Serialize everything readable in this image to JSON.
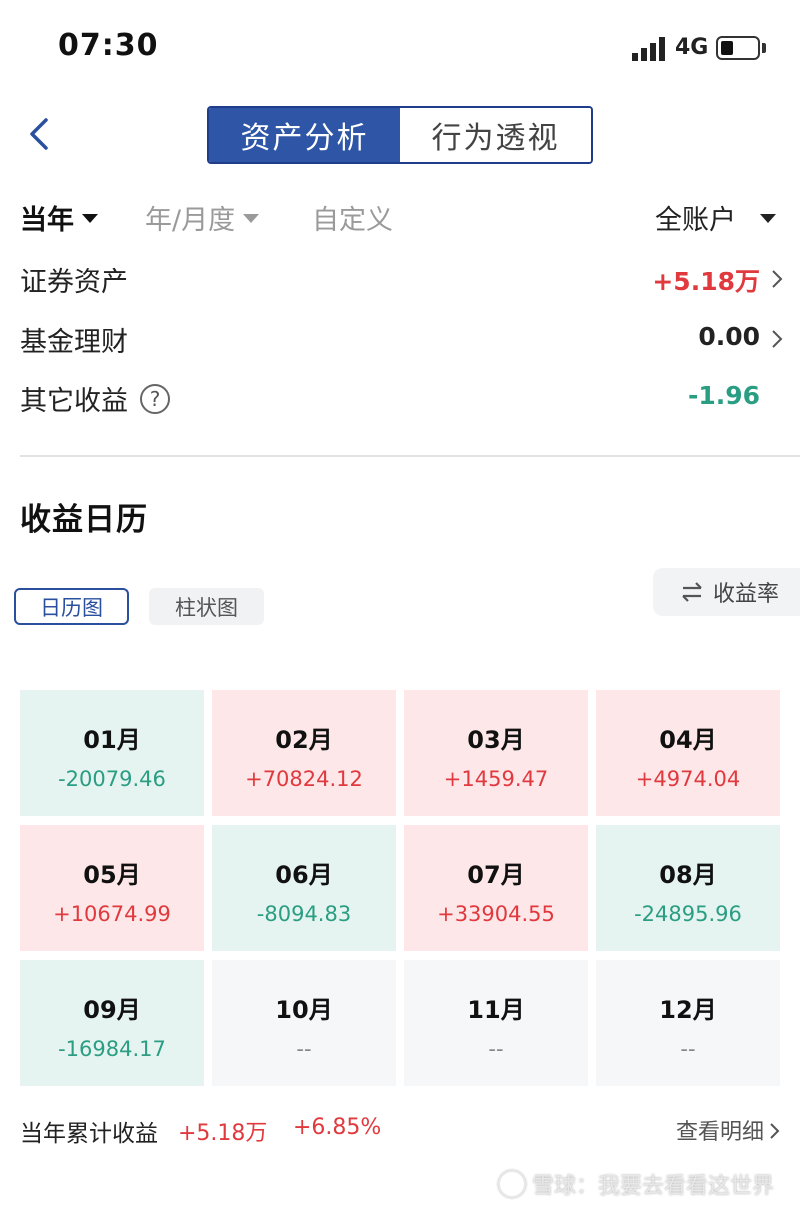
{
  "status_bar": {
    "time": "07:30",
    "network": "4G",
    "battery_level": 0.35
  },
  "header": {
    "tabs": [
      {
        "label": "资产分析",
        "active": true
      },
      {
        "label": "行为透视",
        "active": false
      }
    ]
  },
  "filters": {
    "year": "当年",
    "period": "年/月度",
    "custom": "自定义",
    "account": "全账户"
  },
  "assets": [
    {
      "label": "证券资产",
      "value": "+5.18万",
      "trend": "up"
    },
    {
      "label": "基金理财",
      "value": "0.00",
      "trend": "flat"
    },
    {
      "label": "其它收益",
      "value": "-1.96",
      "trend": "down"
    }
  ],
  "calendar": {
    "title": "收益日历",
    "view_calendar": "日历图",
    "view_bar": "柱状图",
    "rate_toggle": "收益率",
    "months": [
      {
        "name": "01月",
        "value": "-20079.46",
        "trend": "neg"
      },
      {
        "name": "02月",
        "value": "+70824.12",
        "trend": "pos"
      },
      {
        "name": "03月",
        "value": "+1459.47",
        "trend": "pos"
      },
      {
        "name": "04月",
        "value": "+4974.04",
        "trend": "pos"
      },
      {
        "name": "05月",
        "value": "+10674.99",
        "trend": "pos"
      },
      {
        "name": "06月",
        "value": "-8094.83",
        "trend": "neg"
      },
      {
        "name": "07月",
        "value": "+33904.55",
        "trend": "pos"
      },
      {
        "name": "08月",
        "value": "-24895.96",
        "trend": "neg"
      },
      {
        "name": "09月",
        "value": "-16984.17",
        "trend": "neg"
      },
      {
        "name": "10月",
        "value": "--",
        "trend": "empty"
      },
      {
        "name": "11月",
        "value": "--",
        "trend": "empty"
      },
      {
        "name": "12月",
        "value": "--",
        "trend": "empty"
      }
    ]
  },
  "summary": {
    "label": "当年累计收益",
    "amount": "+5.18万",
    "rate": "+6.85%",
    "detail_link": "查看明细"
  },
  "watermark": "雪球：我要去看看这世界",
  "colors": {
    "accent": "#2f56a6",
    "gain": "#e0393e",
    "loss": "#2a9d83"
  }
}
